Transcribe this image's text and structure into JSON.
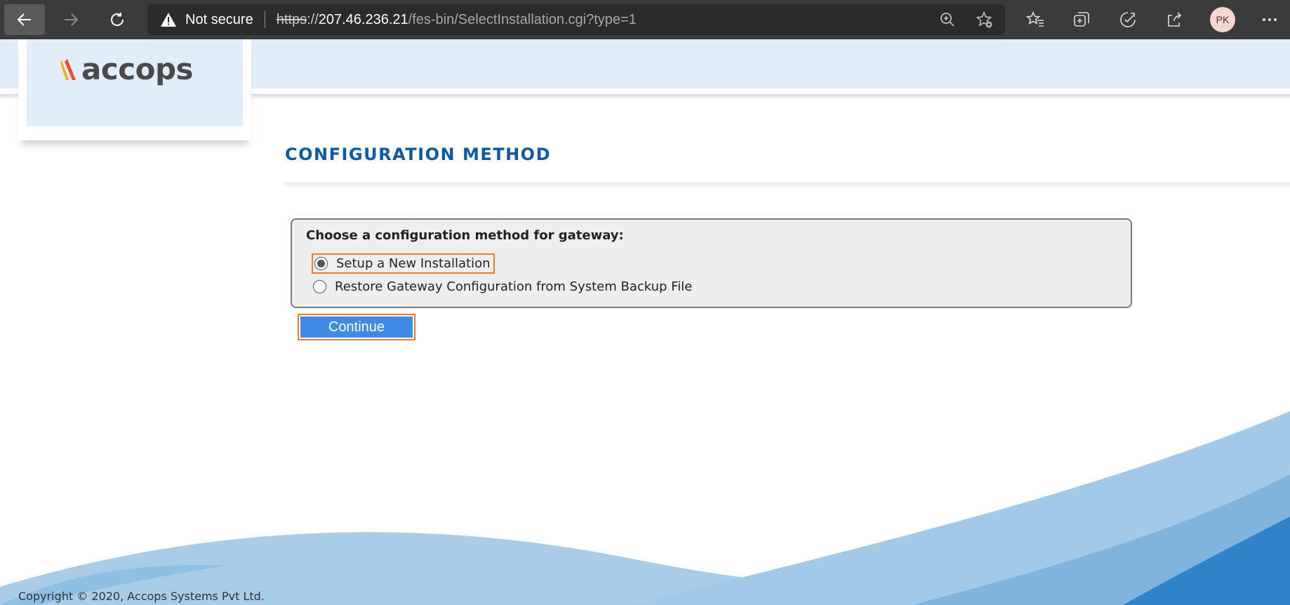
{
  "browser": {
    "security_label": "Not secure",
    "url": {
      "scheme": "https",
      "separator": "://",
      "host": "207.46.236.21",
      "path": "/fes-bin/SelectInstallation.cgi?type=1"
    },
    "profile_initials": "PK",
    "icons": [
      "back-icon",
      "forward-icon",
      "reload-icon",
      "warning-icon",
      "zoom-icon",
      "add-favorite-icon",
      "favorites-icon",
      "collections-icon",
      "performance-icon",
      "share-icon",
      "more-icon"
    ]
  },
  "header": {
    "logo_text": "accops"
  },
  "main": {
    "title": "CONFIGURATION METHOD",
    "prompt": "Choose a configuration method for gateway:",
    "options": [
      {
        "label": "Setup a New Installation",
        "selected": true
      },
      {
        "label": "Restore Gateway Configuration from System Backup File",
        "selected": false
      }
    ],
    "continue_label": "Continue"
  },
  "footer": {
    "copyright": "Copyright © 2020, Accops Systems Pvt Ltd."
  },
  "colors": {
    "accent_blue": "#0d5aa7",
    "button_blue": "#3f8be3",
    "highlight_orange": "#f07a28",
    "band_blue": "#e1eef9"
  }
}
